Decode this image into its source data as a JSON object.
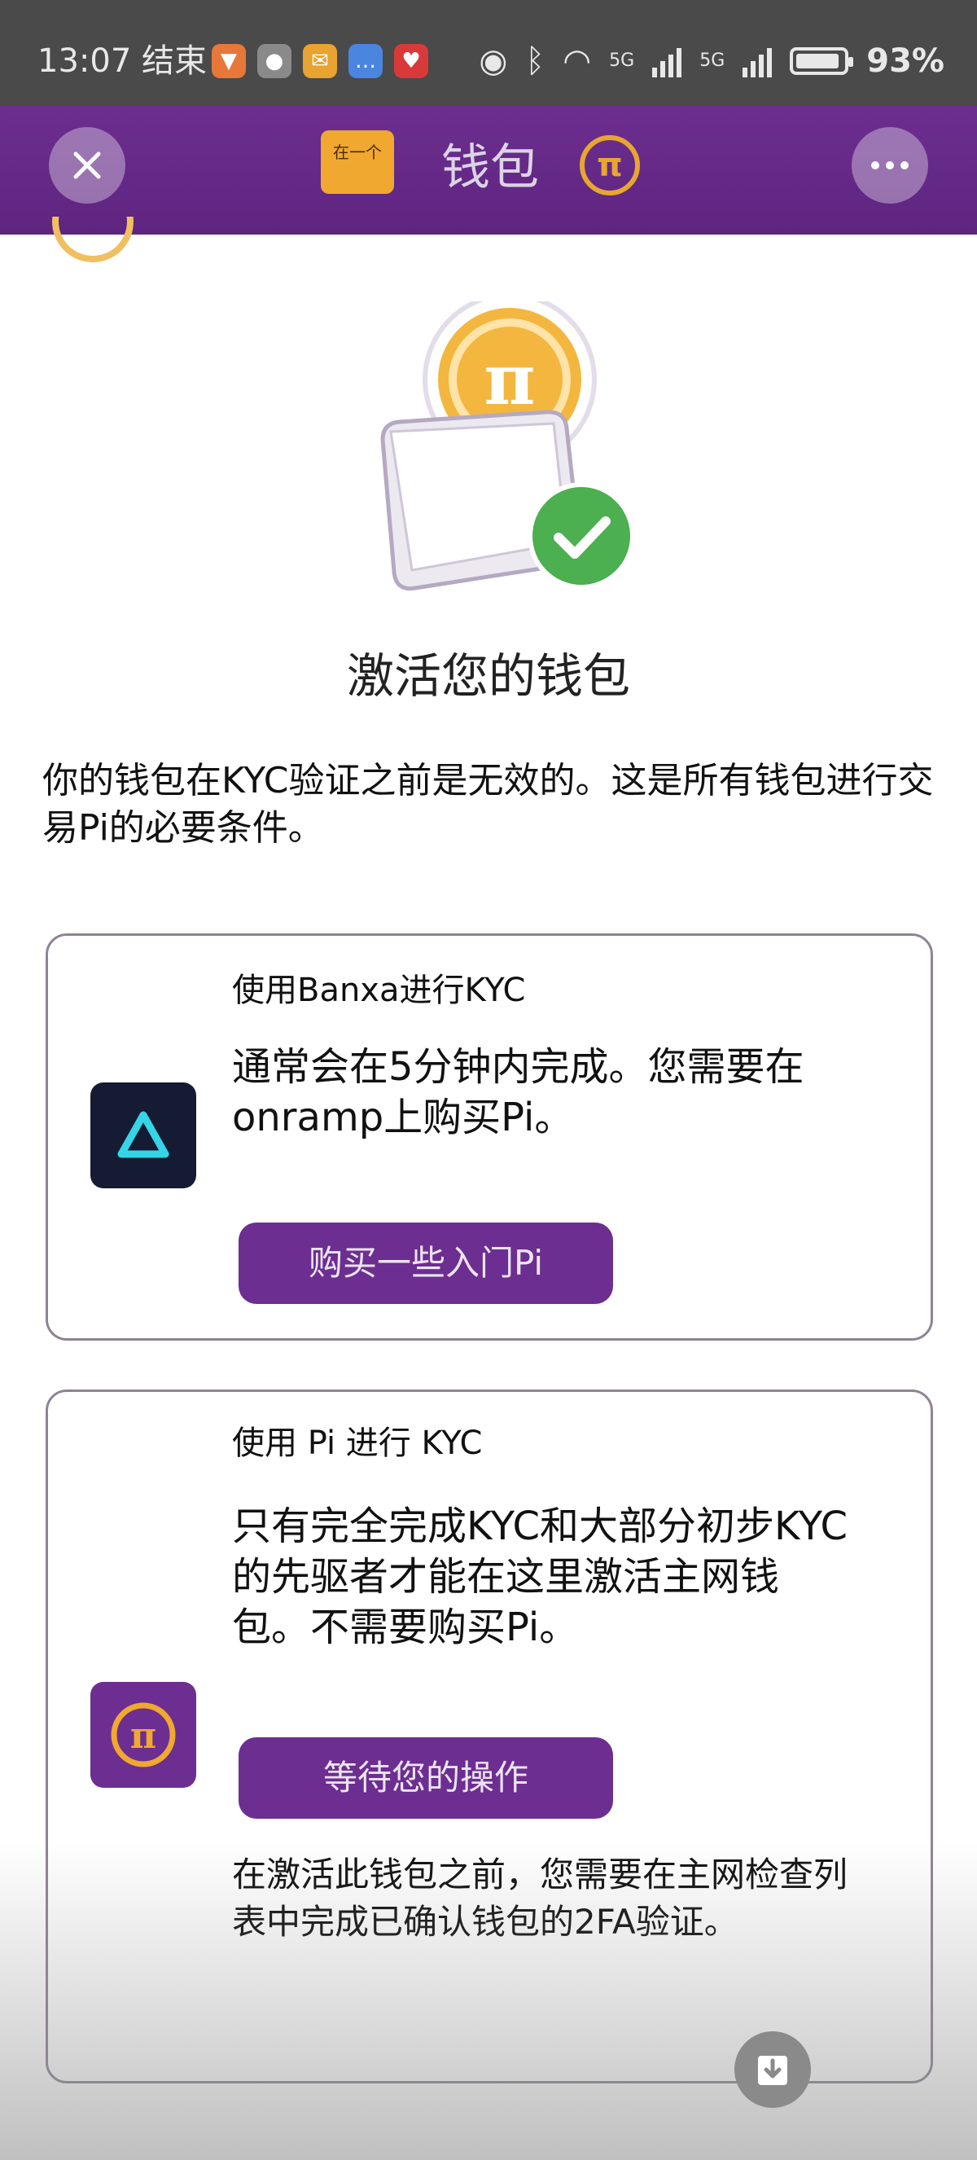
{
  "status_bar": {
    "time": "13:07 结束",
    "network_1": "5G",
    "network_2": "5G",
    "battery_percent": "93%",
    "battery_level": 0.93,
    "app_icons": [
      "taobao-icon",
      "wechat-icon",
      "mail-icon",
      "message-icon",
      "health-icon"
    ]
  },
  "header": {
    "title": "钱包",
    "wallet_badge": "在一个",
    "pi_symbol": "π"
  },
  "main": {
    "title": "激活您的钱包",
    "intro": "你的钱包在KYC验证之前是无效的。这是所有钱包进行交易Pi的必要条件。",
    "cards": [
      {
        "label": "使用Banxa进行KYC",
        "description": "通常会在5分钟内完成。您需要在onramp上购买Pi。",
        "button": "购买一些入门Pi"
      },
      {
        "label": "使用 Pi 进行 KYC",
        "description": "只有完全完成KYC和大部分初步KYC的先驱者才能在这里激活主网钱包。不需要购买Pi。",
        "button": "等待您的操作",
        "note": "在激活此钱包之前，您需要在主网检查列表中完成已确认钱包的2FA验证。"
      }
    ]
  },
  "colors": {
    "brand_purple": "#6c2e91",
    "pi_gold": "#e8a630",
    "check_green": "#4caf50"
  }
}
